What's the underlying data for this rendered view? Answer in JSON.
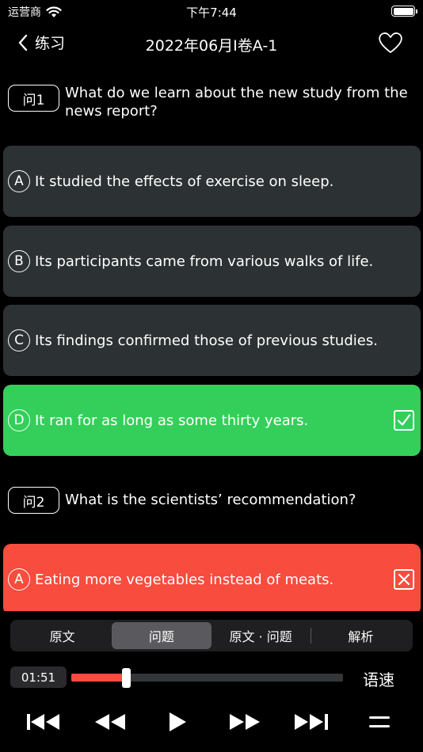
{
  "status_bar": {
    "carrier": "运营商",
    "time": "下午7:44",
    "battery_level": 1.0
  },
  "nav": {
    "back_label": "练习",
    "title": "2022年06月I卷A-1"
  },
  "questions": [
    {
      "badge": "问1",
      "text": "What do we learn about the new study from the news report?",
      "options": [
        {
          "letter": "A",
          "text": "It studied the effects of exercise on sleep.",
          "state": "normal"
        },
        {
          "letter": "B",
          "text": "Its participants came from various walks of life.",
          "state": "normal"
        },
        {
          "letter": "C",
          "text": "Its findings confirmed those of previous studies.",
          "state": "normal"
        },
        {
          "letter": "D",
          "text": "It ran for as long as some thirty years.",
          "state": "correct"
        }
      ]
    },
    {
      "badge": "问2",
      "text": "What is the scientists’ recommendation?",
      "options": [
        {
          "letter": "A",
          "text": "Eating more vegetables instead of meats.",
          "state": "wrong"
        }
      ]
    }
  ],
  "tabs": [
    "原文",
    "问题",
    "原文 · 问题",
    "解析"
  ],
  "active_tab": 1,
  "player": {
    "elapsed": "01:51",
    "progress": 0.2,
    "speed_label": "语速"
  },
  "colors": {
    "correct": "#34cf5a",
    "wrong": "#f74c3e",
    "option_bg": "#2c3133",
    "progress": "#f74c3e"
  },
  "icons": [
    "back-chevron-icon",
    "heart-icon",
    "checkbox-checked-icon",
    "checkbox-x-icon",
    "skip-to-start-icon",
    "rewind-icon",
    "play-icon",
    "fast-forward-icon",
    "skip-to-end-icon",
    "menu-icon"
  ]
}
